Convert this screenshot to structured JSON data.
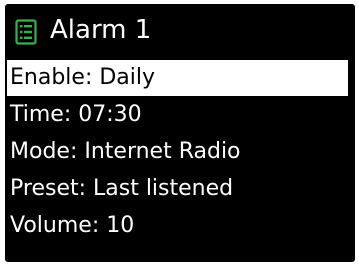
{
  "header": {
    "title": "Alarm 1",
    "icon": "menu-list-icon",
    "icon_color": "#36b24a"
  },
  "menu": {
    "items": [
      {
        "label": "Enable: Daily",
        "selected": true
      },
      {
        "label": "Time: 07:30",
        "selected": false
      },
      {
        "label": "Mode: Internet Radio",
        "selected": false
      },
      {
        "label": "Preset: Last listened",
        "selected": false
      },
      {
        "label": "Volume: 10",
        "selected": false
      }
    ]
  },
  "colors": {
    "background": "#000000",
    "text": "#ffffff",
    "highlight_background": "#ffffff",
    "highlight_text": "#000000"
  }
}
